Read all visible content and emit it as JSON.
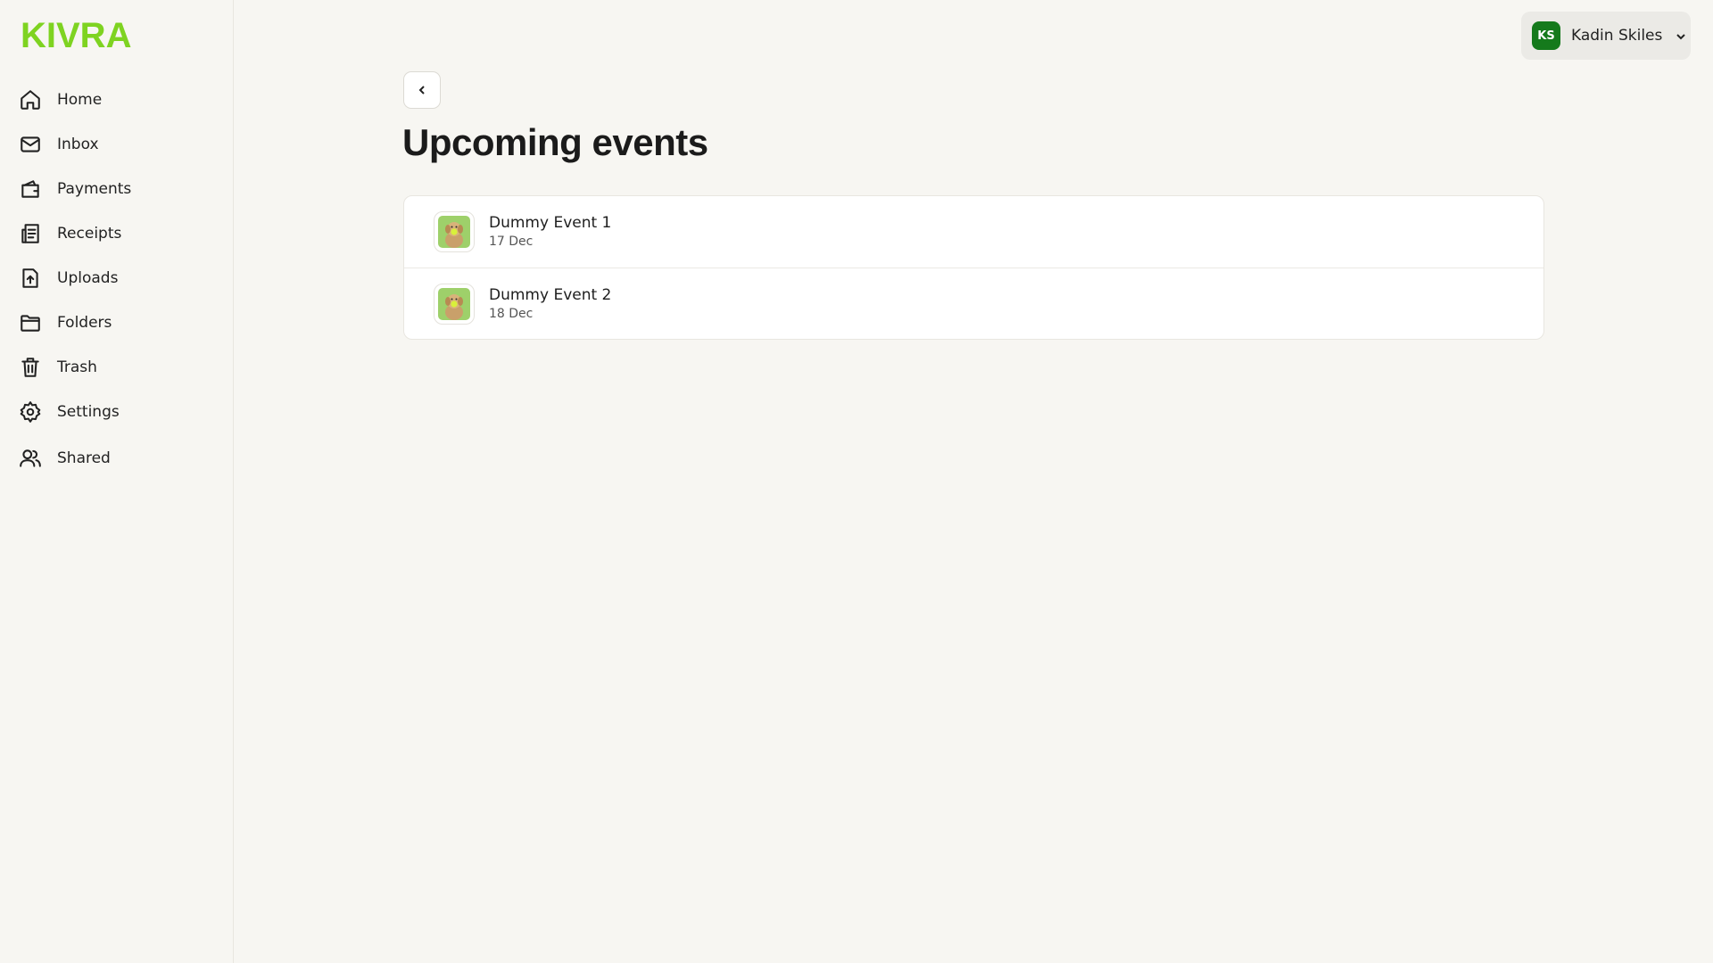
{
  "brand": {
    "logo_text": "KIVRA",
    "accent_color": "#7ed321"
  },
  "sidebar": {
    "items": [
      {
        "label": "Home",
        "icon": "home-icon"
      },
      {
        "label": "Inbox",
        "icon": "mail-icon"
      },
      {
        "label": "Payments",
        "icon": "wallet-icon"
      },
      {
        "label": "Receipts",
        "icon": "receipt-icon"
      },
      {
        "label": "Uploads",
        "icon": "upload-icon"
      },
      {
        "label": "Folders",
        "icon": "folder-icon"
      },
      {
        "label": "Trash",
        "icon": "trash-icon"
      },
      {
        "label": "Settings",
        "icon": "gear-icon"
      },
      {
        "label": "Shared",
        "icon": "users-icon"
      }
    ]
  },
  "user": {
    "initials": "KS",
    "name": "Kadin Skiles",
    "avatar_color": "#157a1c"
  },
  "main": {
    "title": "Upcoming events",
    "events": [
      {
        "title": "Dummy Event 1",
        "date": "17 Dec",
        "thumbnail": "dog-with-ball-image"
      },
      {
        "title": "Dummy Event 2",
        "date": "18 Dec",
        "thumbnail": "dog-with-ball-image"
      }
    ]
  }
}
